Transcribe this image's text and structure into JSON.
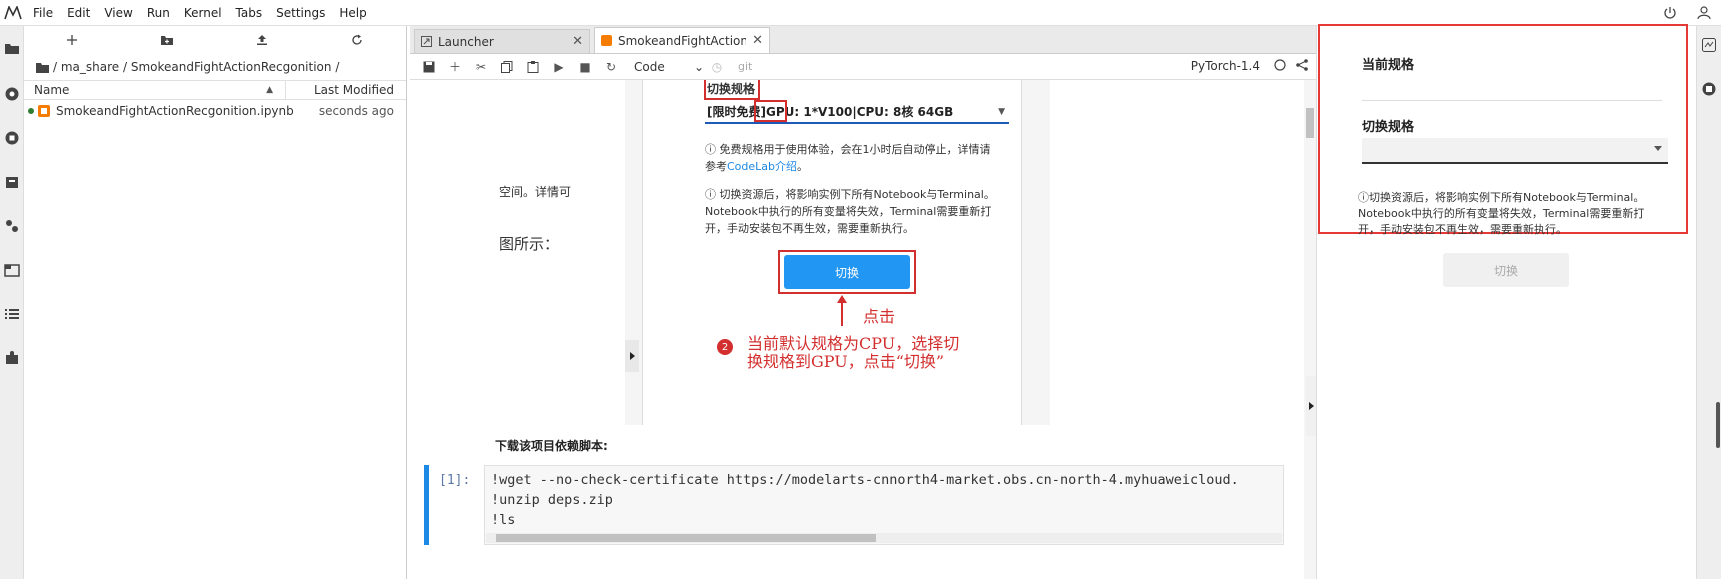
{
  "menubar": {
    "items": [
      "File",
      "Edit",
      "View",
      "Run",
      "Kernel",
      "Tabs",
      "Settings",
      "Help"
    ]
  },
  "filebrowser": {
    "breadcrumb": "/ ma_share / SmokeandFightActionRecgonition /",
    "col_name": "Name",
    "col_modified": "Last Modified",
    "files": [
      {
        "name": "SmokeandFightActionRecgonition.ipynb",
        "modified": "seconds ago"
      }
    ]
  },
  "tabs": [
    {
      "label": "Launcher"
    },
    {
      "label": "SmokeandFightActionRecgonit"
    }
  ],
  "notebook_toolbar": {
    "cell_type": "Code",
    "git_label": "git",
    "kernel": "PyTorch-1.4"
  },
  "embedded_image": {
    "spec_heading": "切换规格",
    "spec_value_prefix": "[限时免费]",
    "spec_value_gpu": "GPU:",
    "spec_value_rest": "1*V100|CPU: 8核 64GB",
    "note1_a": "免费规格用于使用体验，会在1小时后自动停止，详情请",
    "note1_b": "参考",
    "note1_link": "CodeLab介绍",
    "note1_end": "。",
    "note2_a": "切换资源后，将影响实例下所有Notebook与Terminal。",
    "note2_b": "Notebook中执行的所有变量将失效，Terminal需要重新打",
    "note2_c": "开，手动安装包不再生效，需要重新执行。",
    "switch_button": "切换",
    "click_annotation": "点击",
    "step_number": "2",
    "step_line1": "当前默认规格为CPU，选择切",
    "step_line2": "换规格到GPU，点击“切换”",
    "left_text1": "空间。详情可",
    "left_text2": "图所示："
  },
  "section_title": "下载该项目依赖脚本:",
  "code_cell": {
    "prompt": "[1]:",
    "line1": "!wget --no-check-certificate https://modelarts-cnnorth4-market.obs.cn-north-4.myhuaweicloud.",
    "line2": "!unzip deps.zip",
    "line3": "!ls"
  },
  "right_panel": {
    "current_spec_label": "当前规格",
    "current_spec_value": "",
    "switch_spec_label": "切换规格",
    "switch_spec_value": "",
    "note_a": "切换资源后，将影响实例下所有Notebook与Terminal。",
    "note_b": "Notebook中执行的所有变量将失效，Terminal需要重新打",
    "note_c": "开，手动安装包不再生效，需要重新执行。",
    "switch_button": "切换"
  }
}
